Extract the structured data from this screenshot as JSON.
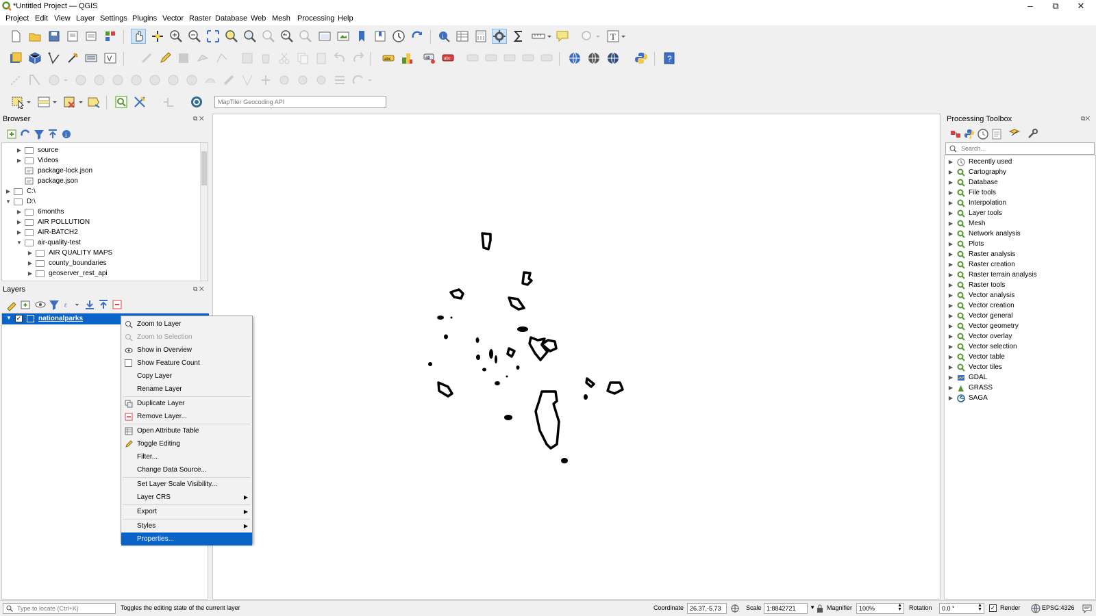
{
  "window": {
    "title": "*Untitled Project — QGIS"
  },
  "menubar": [
    "Project",
    "Edit",
    "View",
    "Layer",
    "Settings",
    "Plugins",
    "Vector",
    "Raster",
    "Database",
    "Web",
    "Mesh",
    "Processing",
    "Help"
  ],
  "geocoder": {
    "placeholder": "MapTiler Geocoding API"
  },
  "browser": {
    "title": "Browser",
    "items": [
      {
        "label": "source",
        "type": "folder",
        "expandable": true
      },
      {
        "label": "Videos",
        "type": "folder",
        "expandable": true
      },
      {
        "label": "package-lock.json",
        "type": "file"
      },
      {
        "label": "package.json",
        "type": "file"
      },
      {
        "label": "C:\\",
        "type": "drive",
        "expandable": true
      },
      {
        "label": "D:\\",
        "type": "drive",
        "expanded": true
      },
      {
        "label": "6months",
        "type": "folder",
        "expandable": true
      },
      {
        "label": "AIR POLLUTION",
        "type": "folder",
        "expandable": true
      },
      {
        "label": "AIR-BATCH2",
        "type": "folder",
        "expandable": true
      },
      {
        "label": "air-quality-test",
        "type": "folder",
        "expanded": true
      },
      {
        "label": "AIR QUALITY MAPS",
        "type": "folder",
        "expandable": true
      },
      {
        "label": "county_boundaries",
        "type": "folder",
        "expandable": true
      },
      {
        "label": "geoserver_rest_api",
        "type": "folder",
        "expandable": true
      }
    ]
  },
  "layers": {
    "title": "Layers",
    "items": [
      {
        "label": "nationalparks",
        "checked": true
      }
    ]
  },
  "context_menu": {
    "items": [
      {
        "label": "Zoom to Layer",
        "icon": "zoom-icon"
      },
      {
        "label": "Zoom to Selection",
        "icon": "zoom-selection-icon",
        "disabled": true
      },
      {
        "label": "Show in Overview",
        "icon": "overview-icon"
      },
      {
        "label": "Show Feature Count",
        "icon": "checkbox-icon"
      },
      {
        "label": "Copy Layer"
      },
      {
        "label": "Rename Layer"
      },
      {
        "label": "Duplicate Layer",
        "icon": "duplicate-icon"
      },
      {
        "label": "Remove Layer...",
        "icon": "remove-icon"
      },
      {
        "label": "Open Attribute Table",
        "icon": "table-icon"
      },
      {
        "label": "Toggle Editing",
        "icon": "pencil-icon"
      },
      {
        "label": "Filter..."
      },
      {
        "label": "Change Data Source..."
      },
      {
        "label": "Set Layer Scale Visibility..."
      },
      {
        "label": "Layer CRS",
        "submenu": true
      },
      {
        "label": "Export",
        "submenu": true
      },
      {
        "label": "Styles",
        "submenu": true
      },
      {
        "label": "Properties...",
        "selected": true
      }
    ]
  },
  "toolbox": {
    "title": "Processing Toolbox",
    "search_placeholder": "Search...",
    "items": [
      "Recently used",
      "Cartography",
      "Database",
      "File tools",
      "Interpolation",
      "Layer tools",
      "Mesh",
      "Network analysis",
      "Plots",
      "Raster analysis",
      "Raster creation",
      "Raster terrain analysis",
      "Raster tools",
      "Vector analysis",
      "Vector creation",
      "Vector general",
      "Vector geometry",
      "Vector overlay",
      "Vector selection",
      "Vector table",
      "Vector tiles",
      "GDAL",
      "GRASS",
      "SAGA"
    ]
  },
  "statusbar": {
    "locate_placeholder": "Type to locate (Ctrl+K)",
    "message": "Toggles the editing state of the current layer",
    "coordinate_label": "Coordinate",
    "coordinate_value": "26.37,-5.73",
    "scale_label": "Scale",
    "scale_value": "1:8842721",
    "magnifier_label": "Magnifier",
    "magnifier_value": "100%",
    "rotation_label": "Rotation",
    "rotation_value": "0.0 °",
    "render_label": "Render",
    "crs_label": "EPSG:4326"
  },
  "colors": {
    "selection": "#0a64c8",
    "qgis_green": "#589632"
  }
}
